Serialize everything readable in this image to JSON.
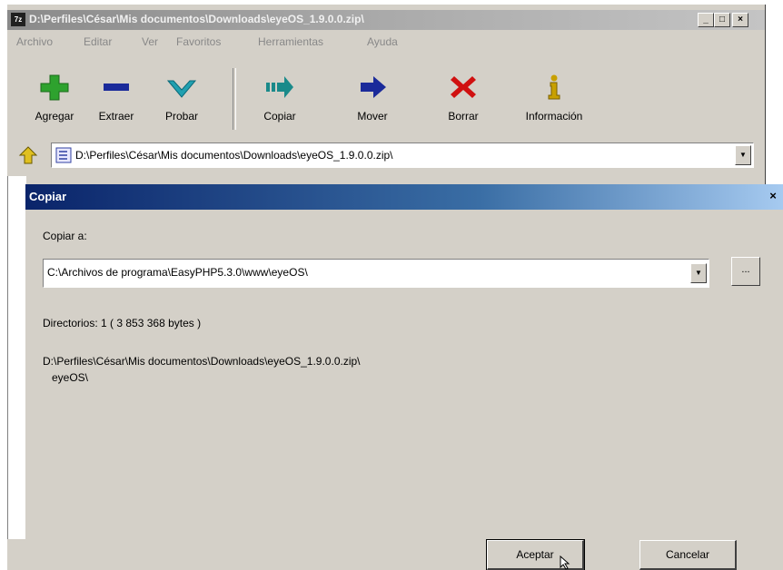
{
  "window": {
    "title": "D:\\Perfiles\\César\\Mis documentos\\Downloads\\eyeOS_1.9.0.0.zip\\",
    "app_icon_text": "7z",
    "caption_buttons": [
      "_",
      "□",
      "×"
    ]
  },
  "menu": [
    "Archivo",
    "Editar",
    "Ver",
    "Favoritos",
    "Herramientas",
    "Ayuda"
  ],
  "toolbar": {
    "add": "Agregar",
    "extract": "Extraer",
    "test": "Probar",
    "copy": "Copiar",
    "move": "Mover",
    "delete": "Borrar",
    "info": "Información"
  },
  "address": {
    "value": "D:\\Perfiles\\César\\Mis documentos\\Downloads\\eyeOS_1.9.0.0.zip\\"
  },
  "dialog": {
    "title": "Copiar",
    "copy_to_label": "Copiar a:",
    "destination": "C:\\Archivos de programa\\EasyPHP5.3.0\\www\\eyeOS\\",
    "browse_label": "...",
    "dirs_info": "Directorios: 1    ( 3 853 368 bytes )",
    "source_path": "D:\\Perfiles\\César\\Mis documentos\\Downloads\\eyeOS_1.9.0.0.zip\\",
    "source_folder": "eyeOS\\",
    "accept": "Aceptar",
    "cancel": "Cancelar"
  },
  "colors": {
    "dialog_title_start": "#0a246a",
    "dialog_title_end": "#a6caf0",
    "add_icon": "#2ea22e",
    "extract_icon": "#1a2a9a",
    "test_icon": "#20a0b0",
    "copy_icon": "#1a8a8a",
    "move_icon": "#1a2a9a",
    "delete_icon": "#d01010",
    "info_icon": "#c8a000"
  }
}
